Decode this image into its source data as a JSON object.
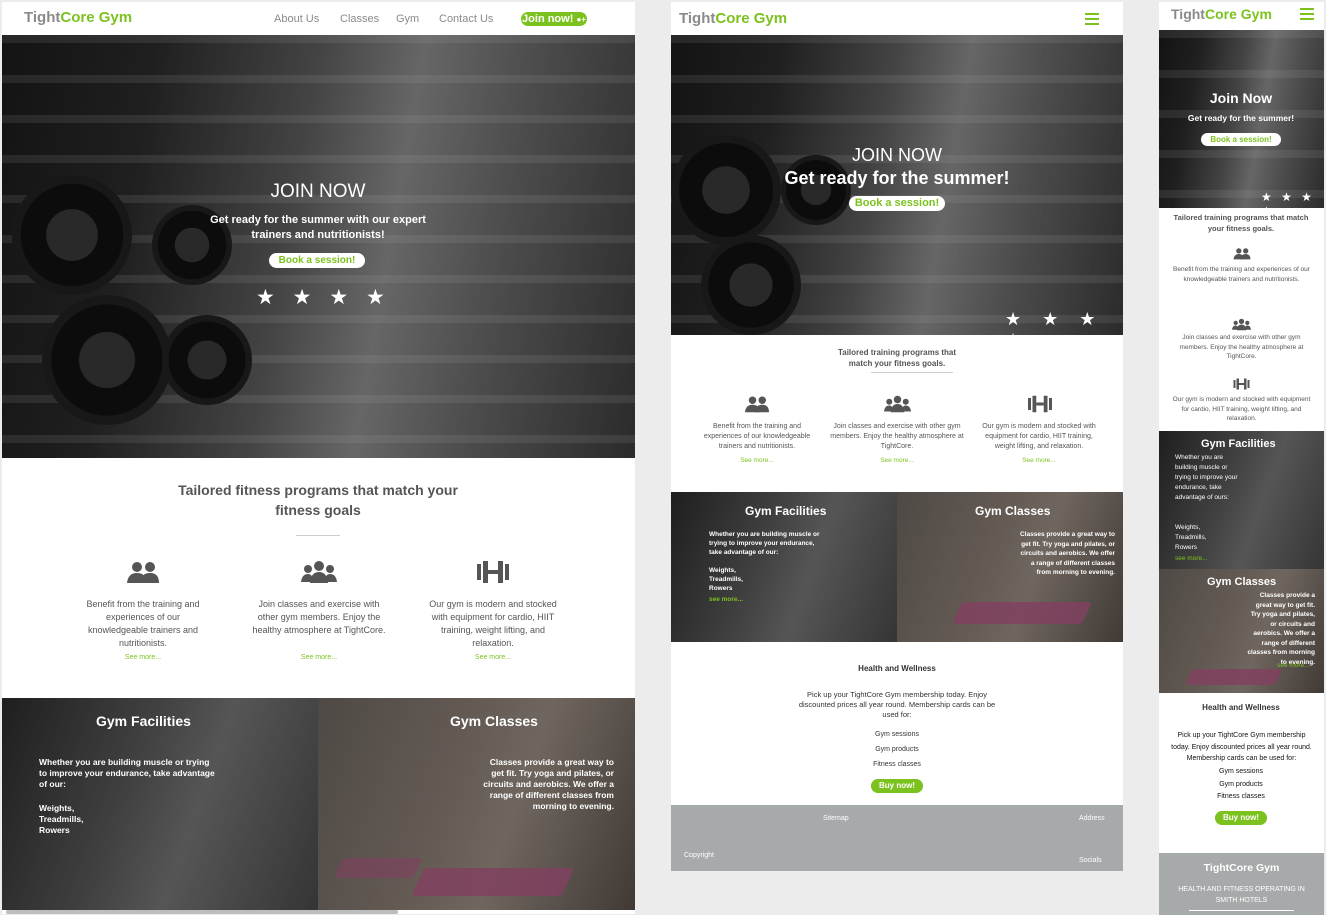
{
  "brand": {
    "tight": "Tight",
    "core": "Core",
    "gym": "Gym"
  },
  "colors": {
    "accent": "#7cc21f",
    "text": "#555555",
    "footer": "#a7aaab"
  },
  "desktop": {
    "nav": [
      "About Us",
      "Classes",
      "Gym",
      "Contact Us"
    ],
    "join_label": "Join now!",
    "hero_title": "JOIN NOW",
    "hero_sub": "Get ready for the summer with our expert trainers and nutritionists!",
    "hero_btn": "Book a session!",
    "stars": "★ ★ ★ ★",
    "section_title": "Tailored fitness programs that match your fitness goals",
    "features": [
      {
        "icon": "users-icon",
        "text": "Benefit from the training and experiences of our knowledgeable trainers and nutritionists.",
        "link": "See more..."
      },
      {
        "icon": "group-icon",
        "text": "Join classes and exercise with other gym members. Enjoy the healthy atmosphere at TightCore.",
        "link": "See more..."
      },
      {
        "icon": "dumbbell-icon",
        "text": "Our gym is modern and stocked with equipment for cardio, HIIT training, weight lifting, and relaxation.",
        "link": "See more..."
      }
    ],
    "facilities_title": "Gym Facilities",
    "facilities_text": "Whether you are building muscle or trying to improve your endurance, take advantage of our:",
    "facilities_list": "Weights, Treadmills, Rowers",
    "classes_title": "Gym Classes",
    "classes_text": "Classes provide a great way to get fit. Try yoga and pilates, or circuits and aerobics. We offer a range of different classes from morning to evening."
  },
  "tablet": {
    "hero_title": "JOIN NOW",
    "hero_sub": "Get ready for the summer!",
    "hero_btn": "Book a session!",
    "stars": "★ ★ ★ ★",
    "section_title": "Tailored training programs that match your fitness goals.",
    "features": [
      {
        "text": "Benefit from the training and experiences of our knowledgeable trainers and nutritionists.",
        "link": "See more..."
      },
      {
        "text": "Join classes and exercise with other gym members. Enjoy the healthy atmosphere at TightCore.",
        "link": "See more..."
      },
      {
        "text": "Our gym is modern and stocked with equipment for cardio, HIIT training, weight lifting, and relaxation.",
        "link": "See more..."
      }
    ],
    "facilities_title": "Gym Facilities",
    "facilities_text": "Whether you are building muscle or trying to improve your endurance, take advantage of our:",
    "facilities_list": "Weights, Treadmills, Rowers",
    "facilities_link": "see more...",
    "classes_title": "Gym Classes",
    "classes_text": "Classes provide a great way to get fit. Try yoga and pilates, or circuits and aerobics. We offer a range of different classes from morning to evening.",
    "health_title": "Health and Wellness",
    "health_text": "Pick up your TightCore Gym membership today. Enjoy discounted prices all year round. Membership cards can be used for:",
    "health_items": [
      "Gym sessions",
      "Gym products",
      "Fitness classes"
    ],
    "buy_btn": "Buy now!",
    "footer": {
      "sitemap": "Sitemap",
      "address": "Address",
      "copyright": "Copyright",
      "socials": "Socials"
    }
  },
  "mobile": {
    "hero_title": "Join Now",
    "hero_sub": "Get ready for the summer!",
    "hero_btn": "Book a session!",
    "stars": "★ ★ ★ ★",
    "section_title": "Tailored training programs that match your fitness goals.",
    "features": [
      {
        "text": "Benefit from the training and experiences of our knowledgeable trainers and nutritionists."
      },
      {
        "text": "Join classes and exercise with other gym members. Enjoy the healthy atmosphere at TightCore."
      },
      {
        "text": "Our gym is modern and stocked with equipment for cardio, HIIT training, weight lifting, and relaxation."
      }
    ],
    "facilities_title": "Gym Facilities",
    "facilities_text": "Whether you are building muscle or trying to improve your endurance, take advantage of ours:",
    "facilities_list": "Weights, Treadmills, Rowers",
    "facilities_link": "see more...",
    "classes_title": "Gym Classes",
    "classes_text": "Classes provide a great way to get fit. Try yoga and pilates, or circuits and aerobics. We offer a range of different classes from morning to evening.",
    "classes_link": "see more...",
    "health_title": "Health and Wellness",
    "health_text": "Pick up your TightCore Gym membership today. Enjoy discounted prices all year round. Membership cards can be used for:",
    "health_items": [
      "Gym sessions",
      "Gym products",
      "Fitness classes"
    ],
    "buy_btn": "Buy now!",
    "footer_title": "TightCore Gym",
    "footer_sub": "HEALTH AND FITNESS OPERATING IN SMITH HOTELS"
  }
}
